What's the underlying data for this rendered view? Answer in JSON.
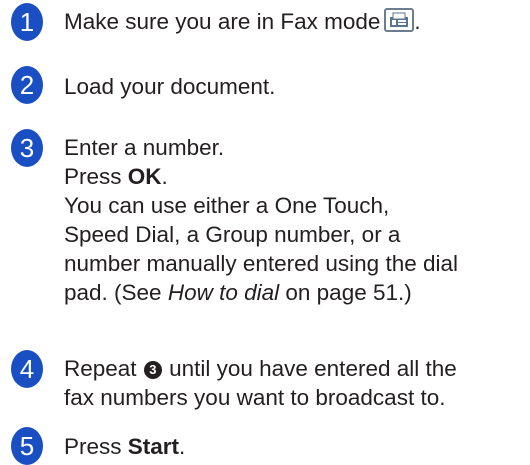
{
  "steps": [
    {
      "number": "1",
      "text": "Make sure you are in Fax mode",
      "after_icon": ".",
      "icon": "fax-mode-icon"
    },
    {
      "number": "2",
      "text": "Load your document."
    },
    {
      "number": "3",
      "line1": "Enter a number.",
      "line2_prefix": "Press ",
      "line2_bold": "OK",
      "line2_suffix": ".",
      "line3": "You can use either a One Touch,",
      "line4": "Speed Dial, a Group number, or a",
      "line5": "number manually entered using the dial",
      "line6_prefix": "pad. (See ",
      "line6_italic": "How to dial",
      "line6_suffix": " on page 51.)"
    },
    {
      "number": "4",
      "prefix": "Repeat ",
      "ref": "3",
      "line1_suffix": " until you have entered all the",
      "line2": "fax numbers you want to broadcast to."
    },
    {
      "number": "5",
      "prefix": "Press ",
      "bold": "Start",
      "suffix": "."
    }
  ],
  "colors": {
    "step_circle": "#1a4fc4",
    "text": "#231f20"
  }
}
